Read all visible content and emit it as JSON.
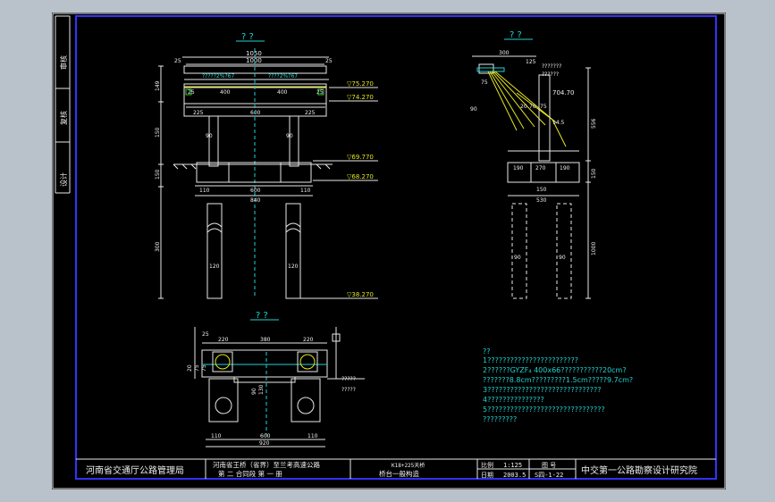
{
  "side_labels": [
    "审核",
    "复核",
    "设计"
  ],
  "views": {
    "elevation": {
      "title": "? ?",
      "dims_top": [
        "1050",
        "1000"
      ],
      "dim_25a": "25",
      "dim_25b": "25",
      "dims_cap": [
        "25",
        "400",
        "400",
        "25"
      ],
      "dims_mid": [
        "225",
        "600",
        "225"
      ],
      "dim_col": "90",
      "dim_col2": "90",
      "dims_tie": [
        "110",
        "600",
        "110"
      ],
      "dim_tie_total": "840",
      "dim_pile_a": "120",
      "dim_pile_b": "120",
      "left_dims": [
        "149",
        "150",
        "150",
        "300"
      ],
      "slope_note": "?????2%?67",
      "slope_note2": "????2%?67",
      "elev": [
        "▽75.270",
        "▽74.270",
        "▽69.770",
        "▽68.270",
        "▽38.270"
      ]
    },
    "side": {
      "title": "? ?",
      "dims_top": [
        "300",
        "125"
      ],
      "dim_75": "75",
      "notes": [
        "???????",
        "??????",
        "704.70"
      ],
      "col_labels": [
        "20",
        "70",
        "75"
      ],
      "dim_145": "14.5",
      "dims_tie": [
        "190",
        "270",
        "190"
      ],
      "dim_150": "150",
      "dim_total": "530",
      "dim_pile": [
        "90",
        "90"
      ],
      "dims_right": [
        "556",
        "150",
        "1000"
      ],
      "dim_left": "90"
    },
    "plan": {
      "title": "? ?",
      "dims_top": [
        "220",
        "380",
        "220"
      ],
      "dim_25": "25",
      "dims_bottom": [
        "110",
        "600",
        "110"
      ],
      "dim_total": "920",
      "left_dims": [
        "20",
        "75",
        "75"
      ],
      "dim_90": "90",
      "dim_130": "130",
      "notes": [
        "?????",
        "?????"
      ]
    }
  },
  "notes": {
    "header": "??",
    "lines": [
      "1????????????????????????",
      "2??????GYZF₄  400x66???????????20cm?",
      "  ???????8.8cm?????????1.5cm?????9.7cm?",
      "3??????????????????????????????",
      "4???????????????",
      "5???????????????????????????????",
      "  ?????????"
    ]
  },
  "title_block": {
    "owner": "河南省交通厅公路管理局",
    "project_line1": "河南省王桥（省界）至兰考高速公路",
    "project_line2": "第 二 合同段      第 一 册",
    "drawing_line1": "K18+225天桥",
    "drawing_line2": "桥台一般构造",
    "scale_label": "比例",
    "scale_value": "1:125",
    "date_label": "日期",
    "date_value": "2003.5",
    "sheet_label": "图 号",
    "sheet_value": "S四-1-22",
    "institute": "中交第一公路勘察设计研究院"
  }
}
